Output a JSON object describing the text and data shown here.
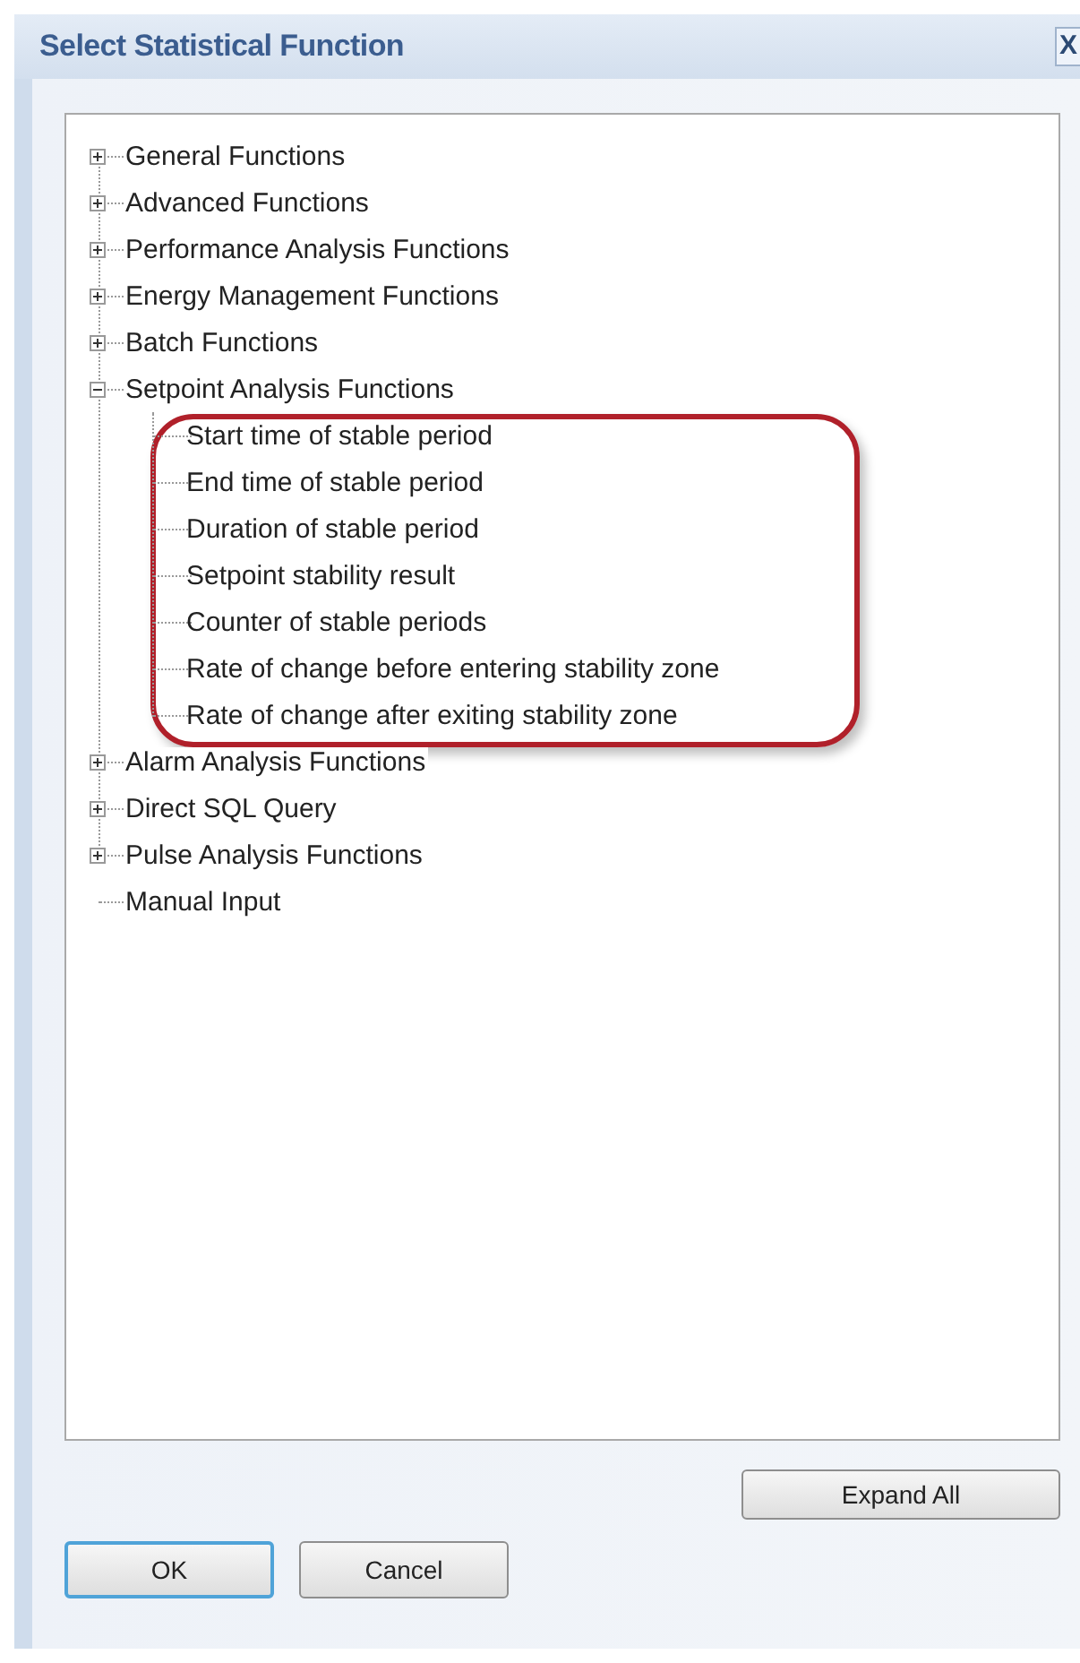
{
  "window": {
    "title": "Select Statistical Function",
    "close_button": "X"
  },
  "tree": [
    {
      "label": "General Functions",
      "expanded": false
    },
    {
      "label": "Advanced Functions",
      "expanded": false
    },
    {
      "label": "Performance Analysis Functions",
      "expanded": false
    },
    {
      "label": "Energy Management Functions",
      "expanded": false
    },
    {
      "label": "Batch Functions",
      "expanded": false
    },
    {
      "label": "Setpoint Analysis Functions",
      "expanded": true,
      "highlighted": true,
      "children": [
        {
          "label": "Start time of stable period"
        },
        {
          "label": "End time of stable period"
        },
        {
          "label": "Duration of stable period"
        },
        {
          "label": "Setpoint stability result"
        },
        {
          "label": "Counter of stable periods"
        },
        {
          "label": "Rate of change before entering stability zone"
        },
        {
          "label": "Rate of change after exiting stability zone"
        }
      ]
    },
    {
      "label": "Alarm Analysis Functions",
      "expanded": false
    },
    {
      "label": "Direct SQL Query",
      "expanded": false
    },
    {
      "label": "Pulse Analysis Functions",
      "expanded": false
    },
    {
      "label": "Manual Input"
    }
  ],
  "expand_all_button": "Expand All",
  "buttons": [
    "OK",
    "Cancel"
  ]
}
